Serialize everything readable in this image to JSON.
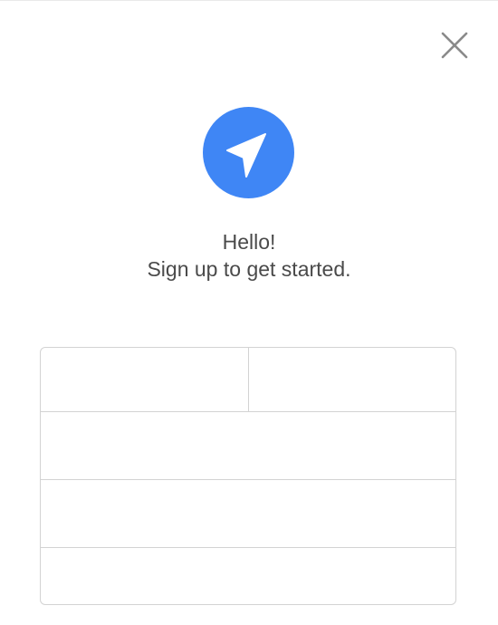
{
  "colors": {
    "accent": "#3f86f5",
    "text": "#4a4a4a",
    "border": "#d3d3d3",
    "close_icon": "#8a8a8a"
  },
  "header": {
    "close_icon": "close-icon"
  },
  "logo": {
    "icon": "location-arrow-icon"
  },
  "greeting": {
    "line1": "Hello!",
    "line2": "Sign up to get started."
  },
  "form": {
    "fields": [
      {
        "value": "",
        "placeholder": ""
      },
      {
        "value": "",
        "placeholder": ""
      },
      {
        "value": "",
        "placeholder": ""
      },
      {
        "value": "",
        "placeholder": ""
      },
      {
        "value": "",
        "placeholder": ""
      }
    ]
  }
}
